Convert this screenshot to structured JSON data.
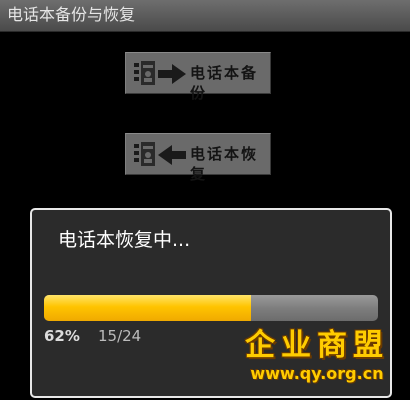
{
  "app": {
    "title": "电话本备份与恢复"
  },
  "buttons": {
    "backup": {
      "label": "电话本备份",
      "icon": "contacts-export-arrow-right-icon"
    },
    "restore": {
      "label": "电话本恢复",
      "icon": "contacts-import-arrow-left-icon"
    }
  },
  "dialog": {
    "message": "电话本恢复中...",
    "progress": {
      "fraction": 0.62,
      "percent_text": "62%",
      "count_text": "15/24"
    }
  },
  "watermark": {
    "title": "企业商盟",
    "url": "www.qy.org.cn"
  },
  "colors": {
    "progress_fill": "#ffc400",
    "watermark": "#ffcc00"
  }
}
